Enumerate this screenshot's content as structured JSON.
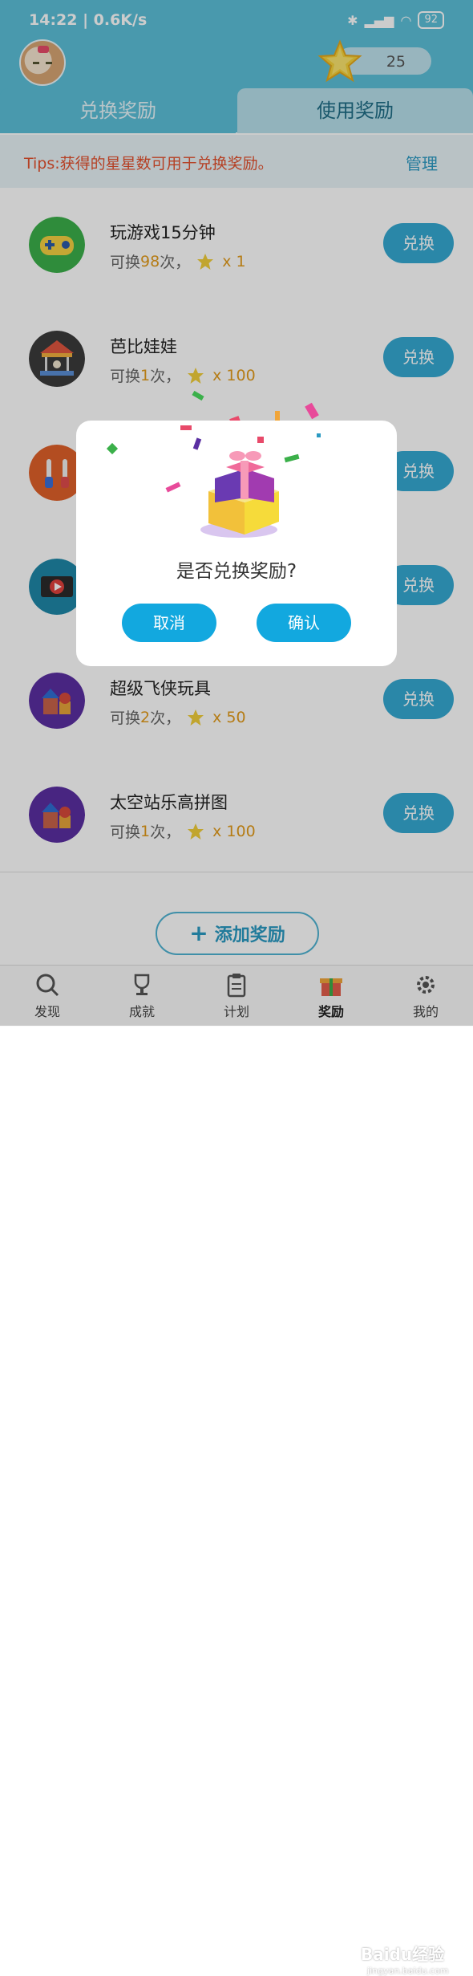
{
  "status": {
    "time": "14:22 | 0.6K/s",
    "battery": "92"
  },
  "header": {
    "star_count": "25"
  },
  "tabs": [
    {
      "label": "兑换奖励"
    },
    {
      "label": "使用奖励"
    }
  ],
  "tips": {
    "text": "Tips:获得的星星数可用于兑换奖励。",
    "manage": "管理"
  },
  "rewards": [
    {
      "title": "玩游戏15分钟",
      "prefix": "可换",
      "num": "98",
      "suffix": "次，",
      "cost": "x 1",
      "button": "兑换"
    },
    {
      "title": "芭比娃娃",
      "prefix": "可换",
      "num": "1",
      "suffix": "次，",
      "cost": "x 100",
      "button": "兑换"
    },
    {
      "title": "",
      "prefix": "",
      "num": "",
      "suffix": "",
      "cost": "",
      "button": "兑换"
    },
    {
      "title": "",
      "prefix": "",
      "num": "",
      "suffix": "",
      "cost": "",
      "button": "兑换"
    },
    {
      "title": "超级飞侠玩具",
      "prefix": "可换",
      "num": "2",
      "suffix": "次，",
      "cost": "x 50",
      "button": "兑换"
    },
    {
      "title": "太空站乐高拼图",
      "prefix": "可换",
      "num": "1",
      "suffix": "次，",
      "cost": "x 100",
      "button": "兑换"
    }
  ],
  "add_button": {
    "plus": "+",
    "label": "添加奖励"
  },
  "dialog": {
    "question": "是否兑换奖励?",
    "cancel": "取消",
    "confirm": "确认"
  },
  "tabbar": [
    {
      "label": "发现",
      "icon": "magnifier-icon"
    },
    {
      "label": "成就",
      "icon": "trophy-icon"
    },
    {
      "label": "计划",
      "icon": "clipboard-icon"
    },
    {
      "label": "奖励",
      "icon": "gift-icon"
    },
    {
      "label": "我的",
      "icon": "gear-icon"
    }
  ],
  "watermark": {
    "text": "Baidu经验",
    "sub": "jingyan.baidu.com"
  },
  "colors": {
    "header": "#5cc0d9",
    "accent": "#35a9d3",
    "tips": "#e3502d",
    "star_num": "#e39b1b"
  }
}
